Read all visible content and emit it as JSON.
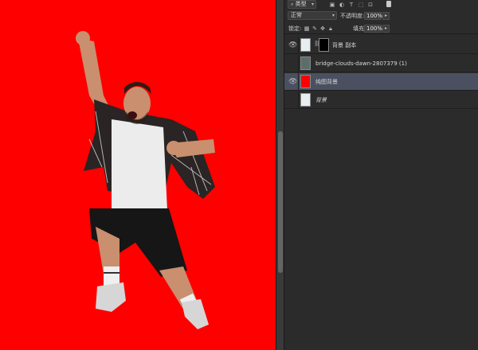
{
  "colors": {
    "canvas": "#ff0000",
    "panel": "#2b2b2b",
    "selected_row": "#4a5060"
  },
  "filter_bar": {
    "kind_label": "类型",
    "icons": [
      "image-filter-icon",
      "adjustment-filter-icon",
      "type-filter-icon",
      "shape-filter-icon",
      "smart-object-filter-icon"
    ]
  },
  "blend": {
    "mode": "正常",
    "opacity_label": "不透明度:",
    "opacity_value": "100%"
  },
  "lock": {
    "label": "锁定:",
    "fill_label": "填充:",
    "fill_value": "100%"
  },
  "layers": [
    {
      "name": "背景 副本",
      "visible": true,
      "selected": false,
      "thumbnail": "person-photo",
      "has_mask": true,
      "italic": false
    },
    {
      "name": "bridge-clouds-dawn-2807379 (1)",
      "visible": false,
      "selected": false,
      "thumbnail": "bridge-photo",
      "has_mask": false,
      "italic": false
    },
    {
      "name": "纯图背景",
      "visible": true,
      "selected": true,
      "thumbnail": "red-fill",
      "has_mask": false,
      "italic": false
    },
    {
      "name": "背景",
      "visible": false,
      "selected": false,
      "thumbnail": "person-photo",
      "has_mask": false,
      "italic": true
    }
  ]
}
